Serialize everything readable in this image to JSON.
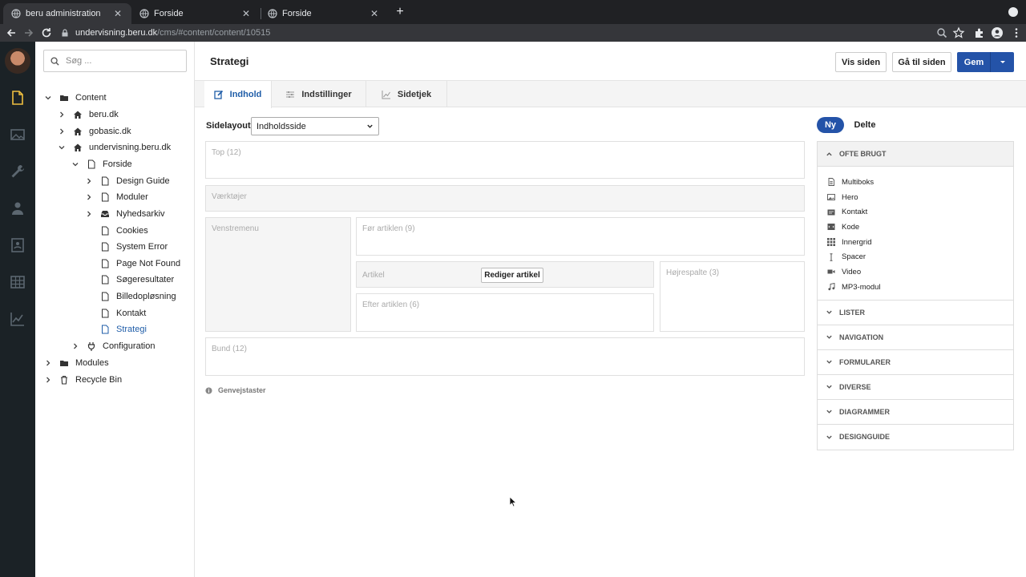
{
  "browser": {
    "tabs": [
      {
        "label": "beru administration",
        "active": true
      },
      {
        "label": "Forside",
        "active": false
      },
      {
        "label": "Forside",
        "active": false
      }
    ],
    "url_host": "undervisning.beru.dk",
    "url_path": "/cms/#content/content/10515"
  },
  "sidebar": {
    "search_placeholder": "Søg ...",
    "tree": [
      {
        "label": "Content",
        "icon": "folder-icon"
      },
      {
        "label": "beru.dk",
        "icon": "home-icon"
      },
      {
        "label": "gobasic.dk",
        "icon": "home-icon"
      },
      {
        "label": "undervisning.beru.dk",
        "icon": "home-icon"
      },
      {
        "label": "Forside",
        "icon": "page-icon"
      },
      {
        "label": "Design Guide",
        "icon": "page-icon"
      },
      {
        "label": "Moduler",
        "icon": "page-icon"
      },
      {
        "label": "Nyhedsarkiv",
        "icon": "inbox-icon"
      },
      {
        "label": "Cookies",
        "icon": "page-icon"
      },
      {
        "label": "System Error",
        "icon": "page-icon"
      },
      {
        "label": "Page Not Found",
        "icon": "page-icon"
      },
      {
        "label": "Søgeresultater",
        "icon": "page-icon"
      },
      {
        "label": "Billedopløsning",
        "icon": "page-icon"
      },
      {
        "label": "Kontakt",
        "icon": "page-icon"
      },
      {
        "label": "Strategi",
        "icon": "page-icon"
      },
      {
        "label": "Configuration",
        "icon": "plug-icon"
      },
      {
        "label": "Modules",
        "icon": "folder-icon"
      },
      {
        "label": "Recycle Bin",
        "icon": "trash-icon"
      }
    ]
  },
  "header": {
    "title": "Strategi",
    "view_label": "Vis siden",
    "goto_label": "Gå til siden",
    "save_label": "Gem"
  },
  "tabs": {
    "content": "Indhold",
    "settings": "Indstillinger",
    "check": "Sidetjek"
  },
  "layout": {
    "label": "Sidelayout",
    "selected": "Indholdsside",
    "zones": {
      "top": "Top (12)",
      "tools": "Værktøjer",
      "left_menu": "Venstremenu",
      "before": "Før artiklen (9)",
      "article": "Artikel",
      "edit_article": "Rediger artikel",
      "right": "Højrespalte (3)",
      "after": "Efter artiklen (6)",
      "bottom": "Bund (12)"
    },
    "shortcuts": "Genvejstaster"
  },
  "panel": {
    "new_label": "Ny",
    "shared_label": "Delte",
    "open_section": "OFTE BRUGT",
    "components": [
      {
        "label": "Multiboks",
        "icon": "document-icon"
      },
      {
        "label": "Hero",
        "icon": "image-icon"
      },
      {
        "label": "Kontakt",
        "icon": "contact-card-icon"
      },
      {
        "label": "Kode",
        "icon": "code-icon"
      },
      {
        "label": "Innergrid",
        "icon": "grid-icon"
      },
      {
        "label": "Spacer",
        "icon": "spacer-icon"
      },
      {
        "label": "Video",
        "icon": "video-icon"
      },
      {
        "label": "MP3-modul",
        "icon": "music-icon"
      }
    ],
    "sections": [
      "LISTER",
      "NAVIGATION",
      "FORMULARER",
      "DIVERSE",
      "DIAGRAMMER",
      "DESIGNGUIDE"
    ]
  },
  "colors": {
    "primary": "#2453a8",
    "rail": "#1b2226",
    "accent_icon": "#f0c040"
  }
}
